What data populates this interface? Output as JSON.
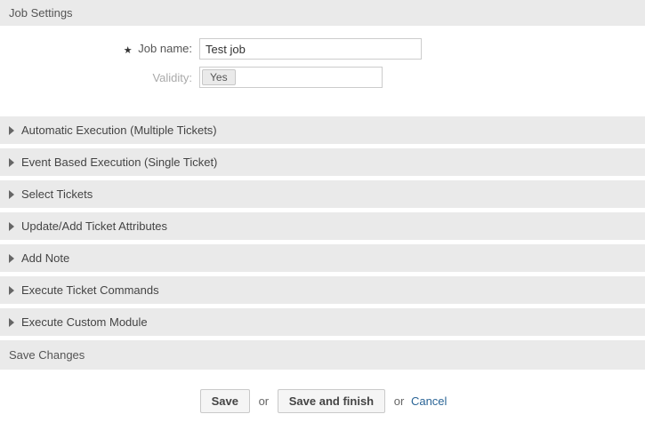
{
  "header": {
    "title": "Job Settings"
  },
  "form": {
    "job_name": {
      "label": "Job name:",
      "value": "Test job",
      "required": true
    },
    "validity": {
      "label": "Validity:",
      "value": "Yes"
    }
  },
  "sections": [
    {
      "title": "Automatic Execution (Multiple Tickets)"
    },
    {
      "title": "Event Based Execution (Single Ticket)"
    },
    {
      "title": "Select Tickets"
    },
    {
      "title": "Update/Add Ticket Attributes"
    },
    {
      "title": "Add Note"
    },
    {
      "title": "Execute Ticket Commands"
    },
    {
      "title": "Execute Custom Module"
    }
  ],
  "save_panel": {
    "title": "Save Changes"
  },
  "actions": {
    "save": "Save",
    "or1": "or",
    "save_finish": "Save and finish",
    "or2": "or",
    "cancel": "Cancel"
  }
}
